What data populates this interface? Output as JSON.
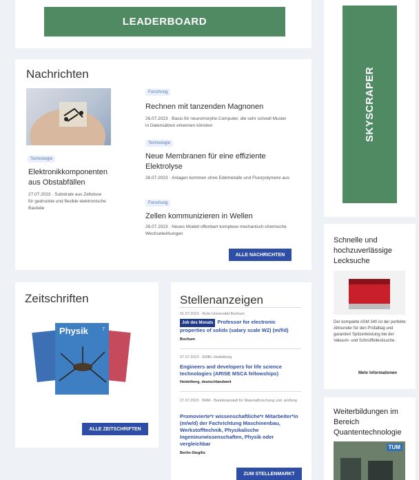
{
  "banners": {
    "leaderboard": "LEADERBOARD",
    "skyscraper": "SKYSCRAPER"
  },
  "news": {
    "title": "Nachrichten",
    "feature": {
      "tag": "Technologie",
      "headline": "Elektronikkomponenten aus Obstabfällen",
      "desc": "27.07.2023 · Substrate aus Zellulose für gedruckte und flexible elektronische Bauteile"
    },
    "items": [
      {
        "tag": "Forschung",
        "headline": "Rechnen mit tanzenden Magnonen",
        "desc": "26.07.2023 · Basis für neuromorphe Computer, die sehr schnell Muster in Datensätzen erkennen könnten"
      },
      {
        "tag": "Technologie",
        "headline": "Neue Membranen für eine effiziente Elektrolyse",
        "desc": "26.07.2023 · Anlagen kommen ohne Edelmetalle und Fluorpolymere aus"
      },
      {
        "tag": "Forschung",
        "headline": "Zellen kommunizieren in Wellen",
        "desc": "26.07.2023 · Neues Modell offenbart komplexe mechanisch-chemische Wechselwirkungen"
      }
    ],
    "button": "ALLE NACHRICHTEN"
  },
  "zeitschriften": {
    "title": "Zeitschriften",
    "cover_title": "Physik",
    "cover_issue": "7",
    "button": "ALLE ZEITSCHRIFTEN"
  },
  "stellen": {
    "title": "Stellenanzeigen",
    "jobs": [
      {
        "meta": "01.07.2023 · Ruhr-Universität Bochum",
        "badge": "Job des Monats",
        "title": "Professor for electronic properties of solids (salary scale W2) (m/f/d)",
        "loc": "Bochum"
      },
      {
        "meta": "27.07.2023 · EMBL Heidelberg",
        "badge": "",
        "title": "Engineers and developers for life science technologies (ARISE MSCA fellowships)",
        "loc": "Heidelberg, deutschlandweit"
      },
      {
        "meta": "27.07.2023 · BAM - Bundesanstalt für Materialforschung und -prüfung",
        "badge": "",
        "title": "Promovierte*r wissenschaftliche*r Mitarbeiter*in (m/w/d) der Fachrichtung Maschinenbau, Werkstofftechnik, Physikalische Ingenieurwissenschaften, Physik oder vergleichbar",
        "loc": "Berlin-Steglitz"
      }
    ],
    "button": "ZUM STELLENMARKT"
  },
  "ad1": {
    "title": "Schnelle und hochzuverlässige Lecksuche",
    "desc": "Der kompakte ASM 340 ist der perfekte Allrounder für den Prüfalltag und garantiert Spitzenleistung bei der Vakuum- und Schnüffellecksuche.",
    "link": "Mehr Informationen"
  },
  "ad2": {
    "title": "Weiterbildungen im Bereich Quantentechnologie",
    "logo": "TUM"
  }
}
